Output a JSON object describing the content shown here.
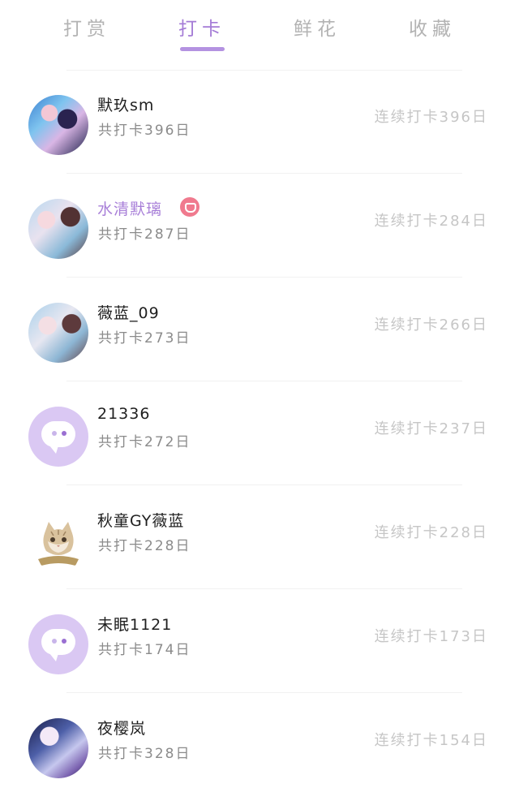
{
  "tabs": [
    {
      "label": "打赏",
      "active": false
    },
    {
      "label": "打卡",
      "active": true
    },
    {
      "label": "鲜花",
      "active": false
    },
    {
      "label": "收藏",
      "active": false
    }
  ],
  "colors": {
    "accent": "#a47bd6",
    "tab_inactive": "#b3b3b3",
    "vip_badge": "#f07a8e",
    "default_avatar_bg": "#dac8f3"
  },
  "rows": [
    {
      "name": "默玖sm",
      "total": "共打卡396日",
      "streak": "连续打卡396日",
      "avatar": "photo-avatar",
      "highlight": false
    },
    {
      "name": "水清默璃",
      "total": "共打卡287日",
      "streak": "连续打卡284日",
      "avatar": "photo-avatar",
      "highlight": true,
      "badge": "vip-heart-icon"
    },
    {
      "name": "薇蓝_09",
      "total": "共打卡273日",
      "streak": "连续打卡266日",
      "avatar": "photo-avatar",
      "highlight": false
    },
    {
      "name": "21336",
      "total": "共打卡272日",
      "streak": "连续打卡237日",
      "avatar": "default-chat-avatar",
      "highlight": false
    },
    {
      "name": "秋童GY薇蓝",
      "total": "共打卡228日",
      "streak": "连续打卡228日",
      "avatar": "cat-avatar",
      "highlight": false
    },
    {
      "name": "未眠1121",
      "total": "共打卡174日",
      "streak": "连续打卡173日",
      "avatar": "default-chat-avatar",
      "highlight": false
    },
    {
      "name": "夜樱岚",
      "total": "共打卡328日",
      "streak": "连续打卡154日",
      "avatar": "photo-avatar",
      "highlight": false
    }
  ]
}
